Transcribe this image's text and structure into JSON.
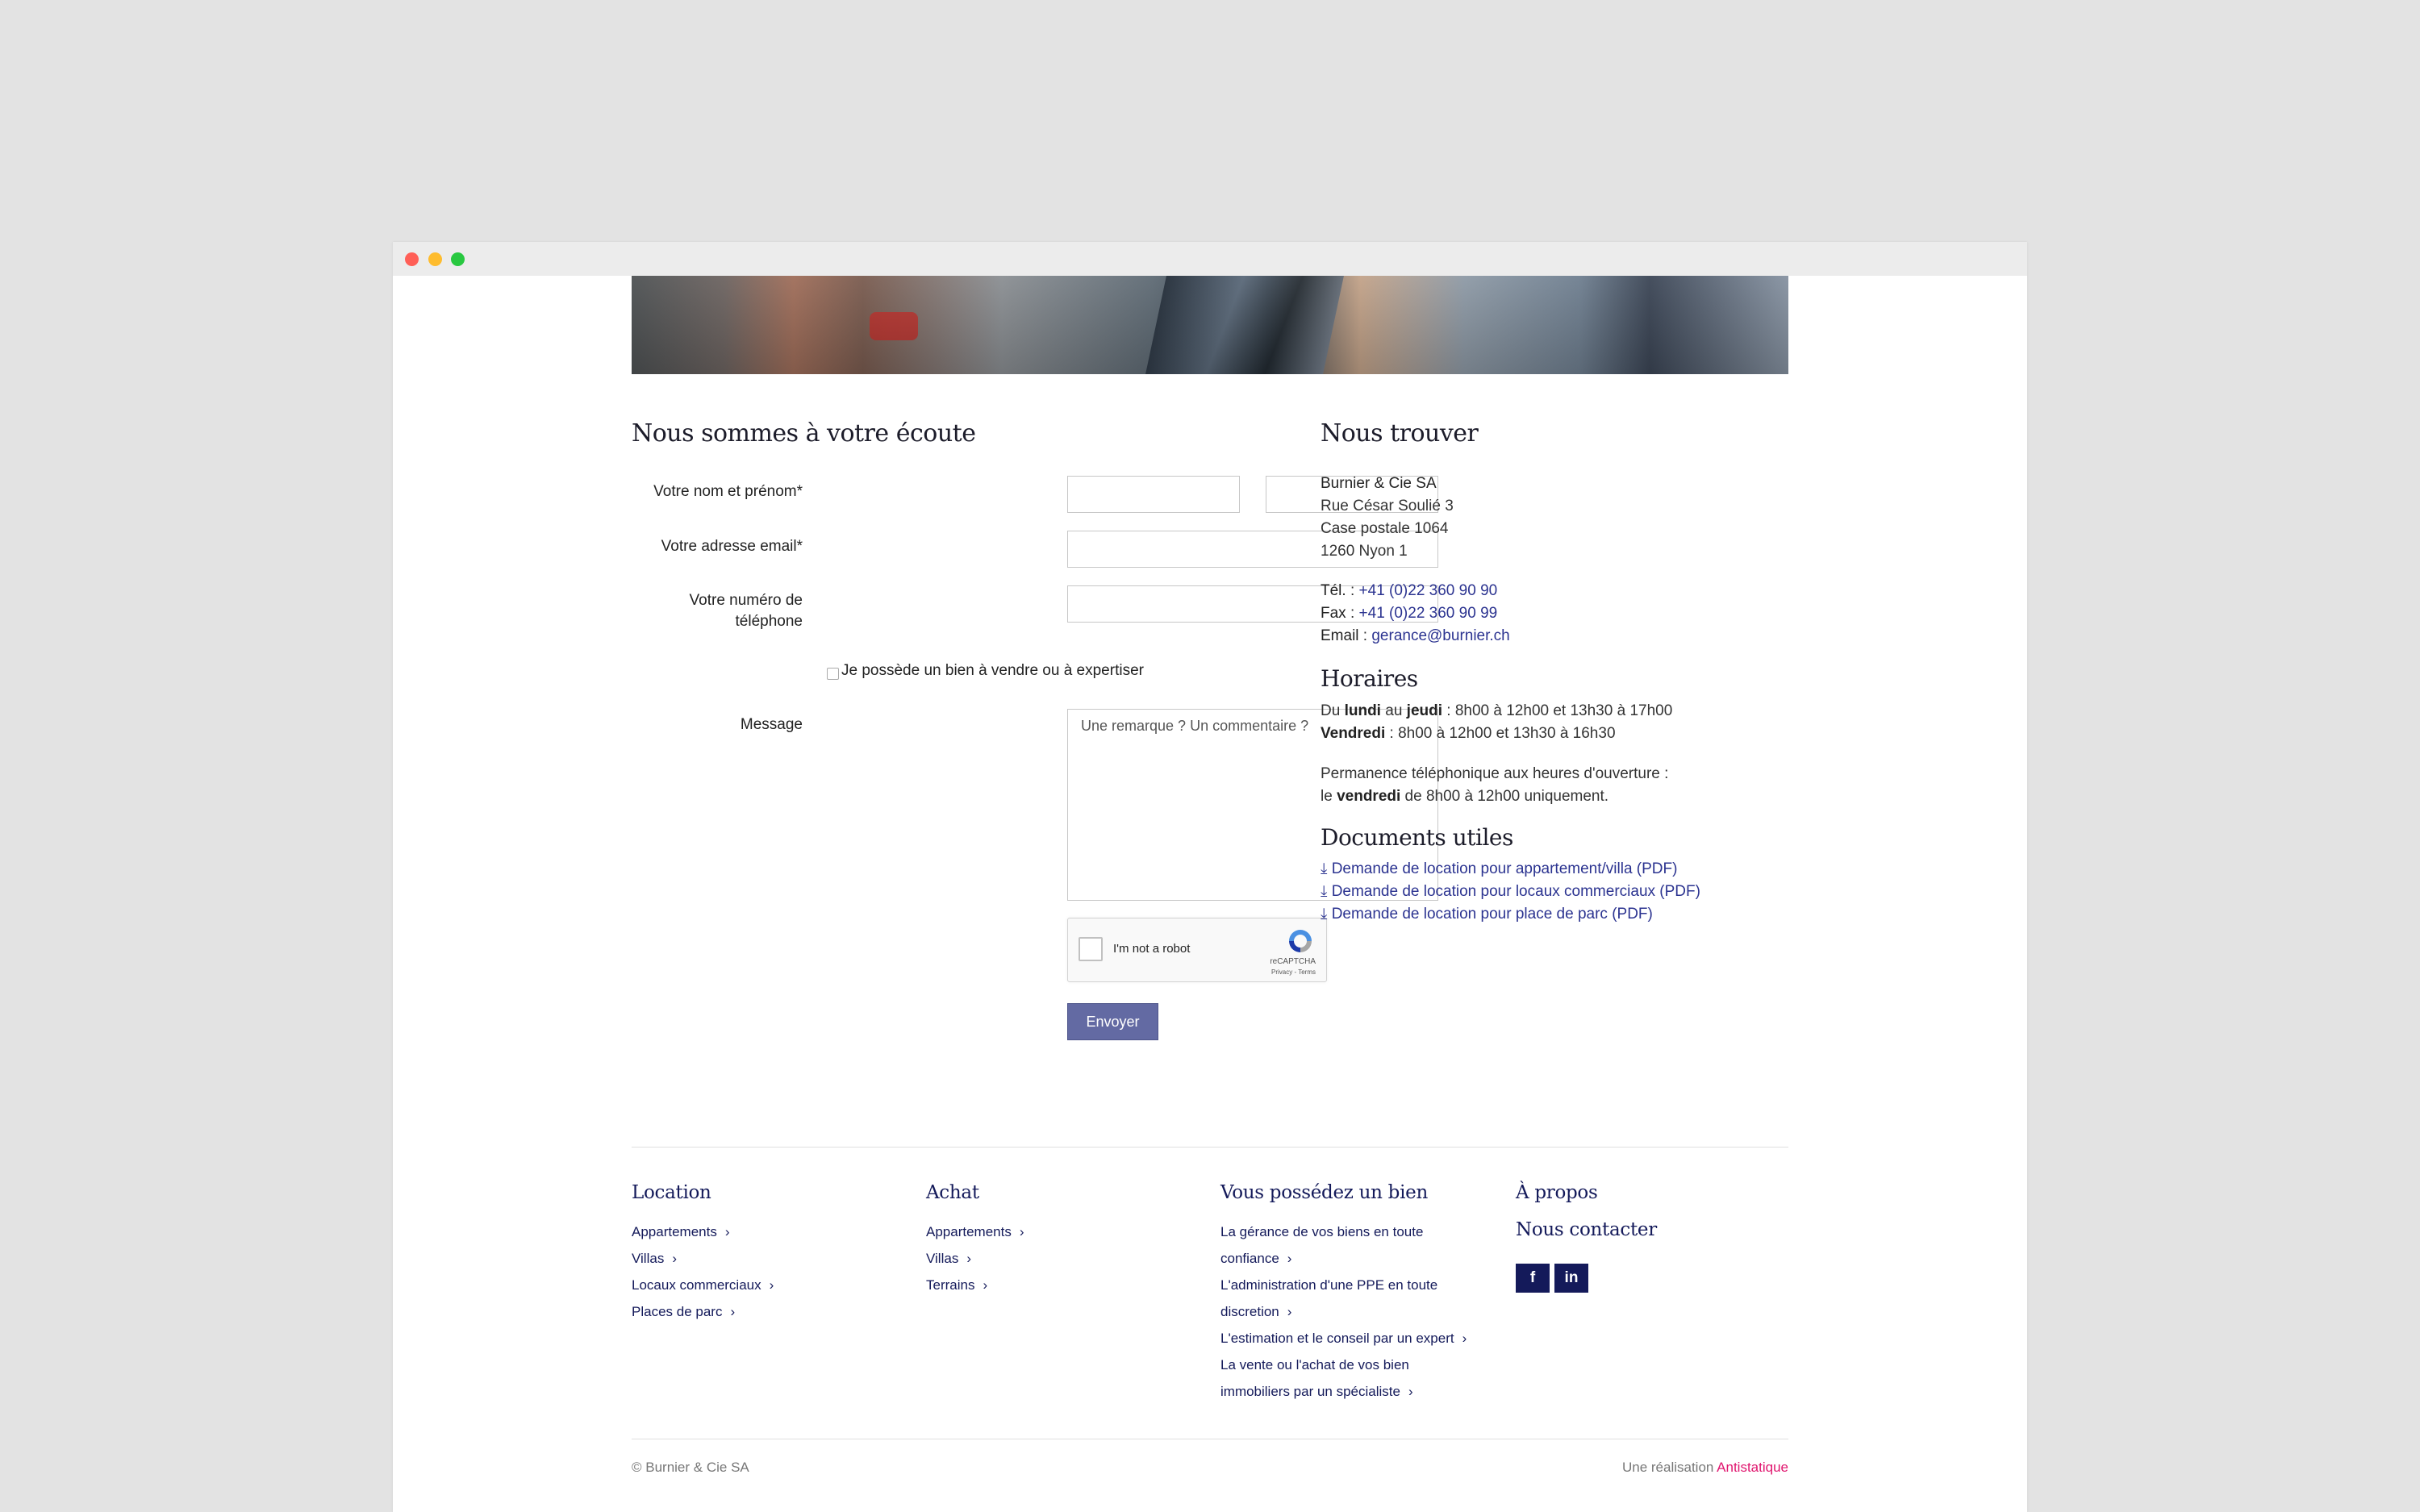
{
  "form": {
    "title": "Nous sommes à votre écoute",
    "name_label": "Votre nom et prénom*",
    "email_label": "Votre adresse email*",
    "phone_label_line1": "Votre numéro de",
    "phone_label_line2": "téléphone",
    "checkbox_label": "Je possède un bien à vendre ou à expertiser",
    "message_label": "Message",
    "message_placeholder": "Une remarque ? Un commentaire ?",
    "recaptcha_text": "I'm not a robot",
    "recaptcha_brand": "reCAPTCHA",
    "recaptcha_terms": "Privacy - Terms",
    "submit_label": "Envoyer"
  },
  "contact": {
    "title": "Nous trouver",
    "company": "Burnier & Cie SA",
    "street": "Rue César Soulié 3",
    "po_box": "Case postale 1064",
    "city": "1260 Nyon 1",
    "tel_label": "Tél.",
    "tel": "+41 (0)22 360 90 90",
    "fax_label": "Fax",
    "fax": "+41 (0)22 360 90 99",
    "email_label": "Email",
    "email": "gerance@burnier.ch"
  },
  "hours": {
    "title": "Horaires",
    "line1_a": "Du ",
    "line1_b": "lundi",
    "line1_c": " au ",
    "line1_d": "jeudi",
    "line1_e": " : 8h00 à 12h00 et 13h30 à 17h00",
    "line2_a": "Vendredi",
    "line2_b": " : 8h00 à 12h00 et 13h30 à 16h30",
    "perm_line1": "Permanence téléphonique aux heures d'ouverture :",
    "perm_a": "le ",
    "perm_b": "vendredi",
    "perm_c": " de 8h00 à 12h00 uniquement."
  },
  "documents": {
    "title": "Documents utiles",
    "items": [
      "Demande de location pour appartement/villa (PDF)",
      "Demande de location pour locaux commerciaux (PDF)",
      "Demande de location pour place de parc (PDF)"
    ]
  },
  "footer": {
    "location": {
      "title": "Location",
      "items": [
        "Appartements",
        "Villas",
        "Locaux commerciaux",
        "Places de parc"
      ]
    },
    "achat": {
      "title": "Achat",
      "items": [
        "Appartements",
        "Villas",
        "Terrains"
      ]
    },
    "bien": {
      "title": "Vous possédez un bien",
      "lines": [
        "La gérance de vos biens en toute",
        "confiance",
        "L'administration d'une PPE en toute",
        "discretion",
        "L'estimation et le conseil par un expert",
        "La vente ou l'achat de vos bien",
        "immobiliers par un spécialiste"
      ]
    },
    "apropos": "À propos",
    "contact": "Nous contacter",
    "social": {
      "facebook": "f",
      "linkedin": "in"
    },
    "copyright": "© Burnier & Cie SA",
    "credit_prefix": "Une réalisation ",
    "credit_name": "Antistatique",
    "credit_color": "#e0156e"
  }
}
